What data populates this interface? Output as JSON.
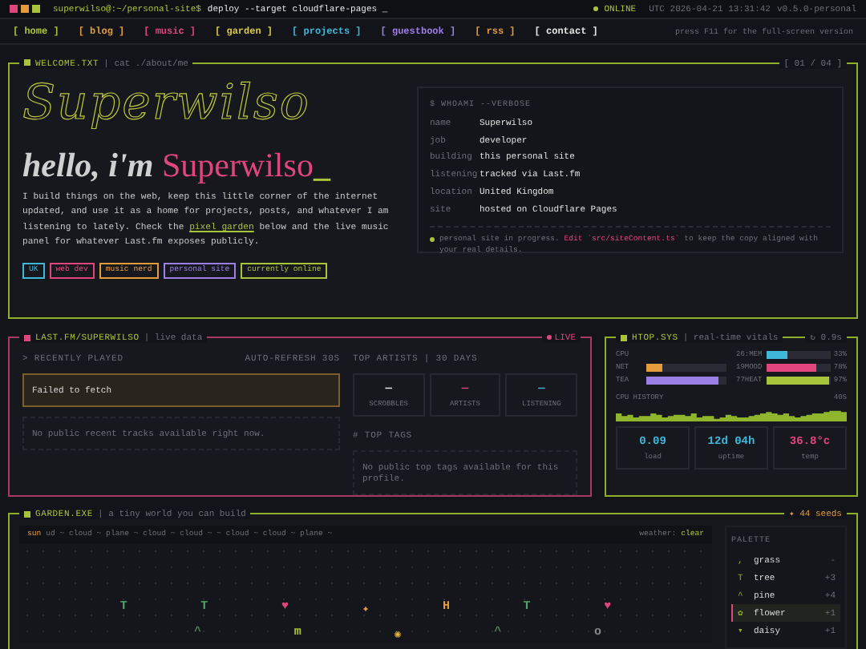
{
  "titlebar": {
    "prompt": "superwilso@:~/personal-site$",
    "command": "deploy --target cloudflare-pages _",
    "status": "ONLINE",
    "clock": "UTC 2026-04-21 13:31:42",
    "version": "v0.5.0-personal"
  },
  "nav": {
    "items": [
      {
        "label": "[ home ]",
        "color": "#a8c43a"
      },
      {
        "label": "[ blog ]",
        "color": "#e39b3c"
      },
      {
        "label": "[ music ]",
        "color": "#e0457b"
      },
      {
        "label": "[ garden ]",
        "color": "#d9c84a"
      },
      {
        "label": "[ projects ]",
        "color": "#3fb7d8"
      },
      {
        "label": "[ guestbook ]",
        "color": "#9b7fe6"
      },
      {
        "label": "[ rss ]",
        "color": "#e39b3c"
      },
      {
        "label": "[ contact ]",
        "color": "#e6e6e6"
      }
    ],
    "hint": "press F11 for the full-screen version"
  },
  "welcome": {
    "title": "WELCOME.TXT",
    "subtitle": "| cat ./about/me",
    "page": "[ 01 / 04 ]",
    "logo": "Superwilso",
    "greeting": "hello, i'm",
    "name": "Superwilso",
    "cursor": "_",
    "paragraph": {
      "before": "I build things on the web, keep this little corner of the internet updated, and use it as a home for projects, posts, and whatever I am listening to lately. Check the",
      "link": "pixel garden",
      "after": "below and the live music panel for whatever Last.fm exposes publicly."
    },
    "tags": [
      {
        "label": "UK",
        "color": "#3fb7d8"
      },
      {
        "label": "web dev",
        "color": "#e0457b"
      },
      {
        "label": "music nerd",
        "color": "#e39b3c"
      },
      {
        "label": "personal site",
        "color": "#9b7fe6"
      },
      {
        "label": "currently online",
        "color": "#a8c43a"
      }
    ],
    "whoami": {
      "command": "$ WHOAMI --VERBOSE",
      "rows": [
        {
          "key": "name",
          "value": "Superwilso"
        },
        {
          "key": "job",
          "value": "developer"
        },
        {
          "key": "building",
          "value": "this personal site"
        },
        {
          "key": "listening",
          "value": "tracked via Last.fm"
        },
        {
          "key": "location",
          "value": "United Kingdom"
        },
        {
          "key": "site",
          "value": "hosted on Cloudflare Pages"
        }
      ],
      "note": {
        "before": "personal site in progress.",
        "highlight": "Edit `src/siteContent.ts`",
        "after": "to keep the copy aligned with your real details."
      }
    }
  },
  "lastfm": {
    "title": "LAST.FM/SUPERWILSO",
    "subtitle": "| live data",
    "live": "LIVE",
    "recent_heading": "> RECENTLY PLAYED",
    "refresh": "AUTO-REFRESH 30S",
    "error": "Failed to fetch",
    "empty": "No public recent tracks available right now.",
    "artists_heading": "TOP ARTISTS | 30 DAYS",
    "stats": [
      {
        "value": "—",
        "label": "SCROBBLES",
        "color": "#e6e6e6"
      },
      {
        "value": "—",
        "label": "ARTISTS",
        "color": "#e0457b"
      },
      {
        "value": "—",
        "label": "LISTENING",
        "color": "#3fb7d8"
      }
    ],
    "tags_heading": "# TOP TAGS",
    "tags_empty": "No public top tags available for this profile."
  },
  "htop": {
    "title": "HTOP.SYS",
    "subtitle": "| real-time vitals",
    "refresh": "↻ 0.9s",
    "meters": [
      {
        "label": "CPU"
      },
      {
        "label": "26:MEM",
        "level": 0.33,
        "color": "#3fb7d8",
        "value": "33%"
      },
      {
        "label": "NET",
        "level": 0.2,
        "color": "#e39b3c"
      },
      {
        "label": "19MOOD",
        "level": 0.78,
        "color": "#e0457b",
        "value": "78%"
      },
      {
        "label": "TEA",
        "level": 0.9,
        "color": "#9b7fe6"
      },
      {
        "label": "77HEAT",
        "level": 0.97,
        "color": "#a8c43a",
        "value": "97%"
      }
    ],
    "history_label": "CPU HISTORY",
    "history_span": "40S",
    "stats": [
      {
        "value": "0.09",
        "label": "load",
        "color": "#3fb7d8"
      },
      {
        "value": "12d 04h",
        "label": "uptime",
        "color": "#3fb7d8"
      },
      {
        "value": "36.8°c",
        "label": "temp",
        "color": "#e0457b"
      }
    ]
  },
  "garden": {
    "title": "GARDEN.EXE",
    "subtitle": "| a tiny world you can build",
    "seeds": "✦ 44 seeds",
    "sun": "sun",
    "sky": "ud ~ cloud ~ plane ~ cloud ~ cloud ~ ~ cloud ~ cloud ~ plane ~",
    "weather_label": "weather:",
    "weather": "clear",
    "rows": [
      [
        {
          "glyph": "T",
          "color": "#4fa56a"
        },
        {
          "glyph": "T",
          "color": "#4fa56a"
        },
        {
          "glyph": "♥",
          "color": "#e0457b"
        },
        {
          "glyph": "✦",
          "color": "#e39b3c"
        },
        {
          "glyph": "H",
          "color": "#e39b3c"
        },
        {
          "glyph": "T",
          "color": "#4fa56a"
        },
        {
          "glyph": "♥",
          "color": "#e0457b"
        }
      ],
      [
        {
          "glyph": "^",
          "color": "#4f7a5a"
        },
        {
          "glyph": "m",
          "color": "#a8c43a"
        },
        {
          "glyph": "✺",
          "color": "#e3b43c"
        },
        {
          "glyph": "^",
          "color": "#4f7a5a"
        },
        {
          "glyph": "o",
          "color": "#888888"
        }
      ]
    ],
    "palette_heading": "PALETTE",
    "palette": [
      {
        "glyph": ",",
        "name": "grass",
        "cost": "-",
        "selected": false
      },
      {
        "glyph": "T",
        "name": "tree",
        "cost": "+3",
        "selected": false
      },
      {
        "glyph": "^",
        "name": "pine",
        "cost": "+4",
        "selected": false
      },
      {
        "glyph": "✿",
        "name": "flower",
        "cost": "+1",
        "selected": true
      },
      {
        "glyph": "▾",
        "name": "daisy",
        "cost": "+1",
        "selected": false
      }
    ]
  }
}
